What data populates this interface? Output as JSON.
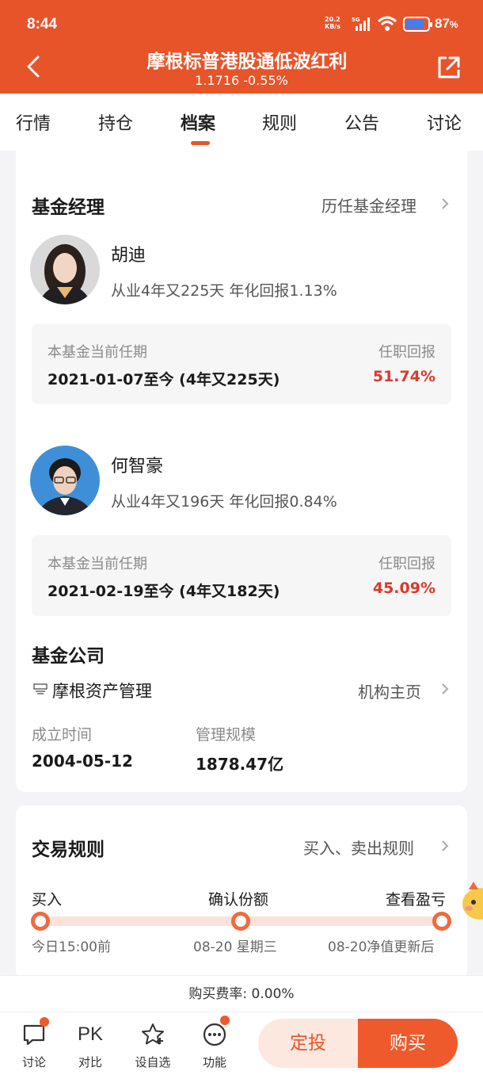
{
  "status_bar": {
    "time": "8:44",
    "net_speed_top": "20.2",
    "net_speed_unit": "KB/s",
    "net_type": "5G",
    "battery": "87",
    "battery_unit": "%"
  },
  "header": {
    "title": "摩根标普港股通低波红利",
    "subtitle": "1.1716 -0.55%"
  },
  "tabs": [
    {
      "label": "行情"
    },
    {
      "label": "持仓"
    },
    {
      "label": "档案",
      "active": true
    },
    {
      "label": "规则"
    },
    {
      "label": "公告"
    },
    {
      "label": "讨论"
    }
  ],
  "fund_manager": {
    "title": "基金经理",
    "history_link": "历任基金经理",
    "managers": [
      {
        "name": "胡迪",
        "meta": "从业4年又225天 年化回报1.13%",
        "term_label": "本基金当前任期",
        "term": "2021-01-07至今 (4年又225天)",
        "return_label": "任职回报",
        "return": "51.74%"
      },
      {
        "name": "何智豪",
        "meta": "从业4年又196天 年化回报0.84%",
        "term_label": "本基金当前任期",
        "term": "2021-02-19至今 (4年又182天)",
        "return_label": "任职回报",
        "return": "45.09%"
      }
    ]
  },
  "company": {
    "title": "基金公司",
    "name": "摩根资产管理",
    "link": "机构主页",
    "founded_label": "成立时间",
    "founded": "2004-05-12",
    "aum_label": "管理规模",
    "aum": "1878.47亿"
  },
  "trade_rules": {
    "title": "交易规则",
    "link": "买入、卖出规则",
    "steps": [
      {
        "label": "买入",
        "sub": "今日15:00前"
      },
      {
        "label": "确认份额",
        "sub": "08-20 星期三"
      },
      {
        "label": "查看盈亏",
        "sub": "08-20净值更新后"
      }
    ]
  },
  "fee": {
    "text": "购买费率: 0.00%"
  },
  "bottom_bar": {
    "nav": [
      {
        "label": "讨论",
        "icon": "chat-icon"
      },
      {
        "label": "对比",
        "icon": "pk-icon",
        "glyph": "PK"
      },
      {
        "label": "设自选",
        "icon": "star-icon"
      },
      {
        "label": "功能",
        "icon": "more-icon"
      }
    ],
    "dingtou": "定投",
    "buy": "购买"
  },
  "colors": {
    "brand": "#e8542a",
    "up": "#d93a2b",
    "muted": "#8a8a8a"
  }
}
